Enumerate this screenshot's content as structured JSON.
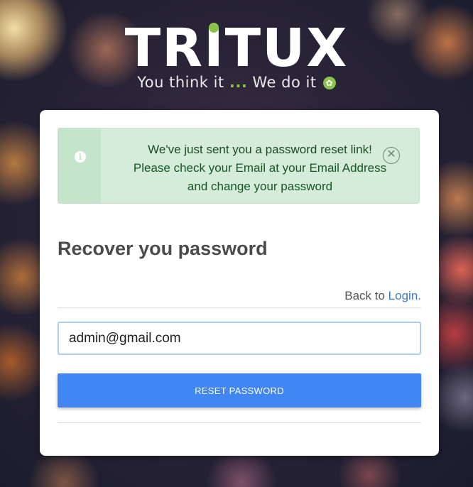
{
  "brand": {
    "logo_text": "TRITUX",
    "tagline_left": "You think it",
    "tagline_dots": "...",
    "tagline_right": "We do it"
  },
  "alert": {
    "title": "We've just sent you a password reset link!",
    "line2": "Please check your Email at your Email Address",
    "line3": "and change your password",
    "info_icon": "info-icon",
    "close_icon": "close-icon",
    "close_symbol": "✕"
  },
  "form": {
    "heading": "Recover you password",
    "back_prefix": "Back to ",
    "login_link": "Login.",
    "email_value": "admin@gmail.com",
    "submit_label": "RESET PASSWORD"
  },
  "colors": {
    "accent": "#4286f4",
    "alert_bg": "#d4ecd9",
    "brand_green": "#8bc34a",
    "link": "#3d7cc9"
  }
}
